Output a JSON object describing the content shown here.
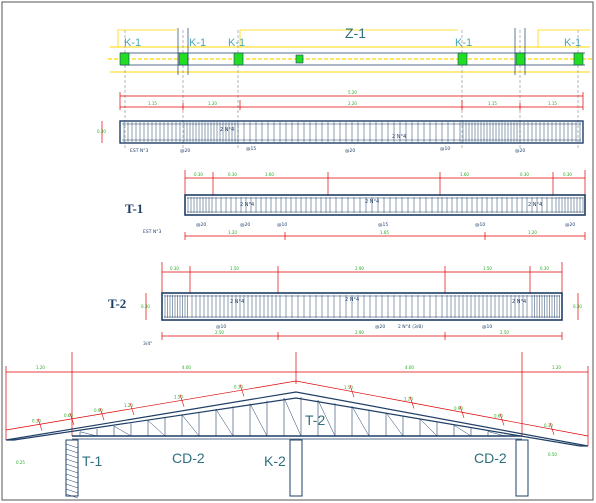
{
  "plan": {
    "column_labels": [
      "K-1",
      "K-1",
      "K-1",
      "Z-1",
      "K-1",
      "K-1"
    ],
    "dims": [
      "5.20",
      "1.15",
      "1.20",
      "2.20",
      "1.15",
      "1.15"
    ],
    "rebar": [
      "2 N°4",
      "2 N°4"
    ],
    "stirrups": [
      "EST N°3",
      "@20",
      "@15",
      "@20",
      "@10",
      "@20"
    ]
  },
  "beam_t1": {
    "label": "T-1",
    "top_dims": [
      "0.30",
      "0.30",
      "1.60",
      "1.60",
      "0.30",
      "0.30"
    ],
    "rebar": [
      "2 N°4",
      "2 N°4",
      "2 N°4"
    ],
    "stirrups": [
      "EST N°3",
      "@20",
      "@20",
      "@10",
      "@15",
      "@10",
      "@20"
    ],
    "bottom_dims": [
      "1.20",
      "1.65",
      "1.20"
    ]
  },
  "beam_t2": {
    "label": "T-2",
    "top_dims": [
      "0.30",
      "1.50",
      "2.90",
      "1.50",
      "0.30"
    ],
    "side_dims": [
      "0.30",
      "0.30"
    ],
    "rebar": [
      "2 N°4",
      "2 N°4",
      "2 N°4",
      "2 N°4 (3/8)"
    ],
    "stirrups": [
      "@10",
      "@20",
      "@10"
    ],
    "bottom_dims": [
      "2.50",
      "2.90",
      "2.50"
    ],
    "note": "3/4\""
  },
  "roof": {
    "top_dims": [
      "1.20",
      "4.00",
      "4.00",
      "1.20"
    ],
    "slope_dims": [
      "0.30",
      "0.60",
      "0.90",
      "1.20",
      "1.50",
      "0.30",
      "1.50",
      "1.20",
      "0.90",
      "0.60",
      "0.30"
    ],
    "labels": [
      "T-1",
      "CD-2",
      "K-2",
      "T-2",
      "CD-2"
    ],
    "small_dims": [
      "0.25",
      "0.50"
    ]
  },
  "colors": {
    "steel": "#1f3f66",
    "dimension": "#e00000",
    "dimension_text": "#22aa22",
    "axis": "#ffd700",
    "column_fill": "#22dd22",
    "axis_label": "#4aa6b8"
  }
}
